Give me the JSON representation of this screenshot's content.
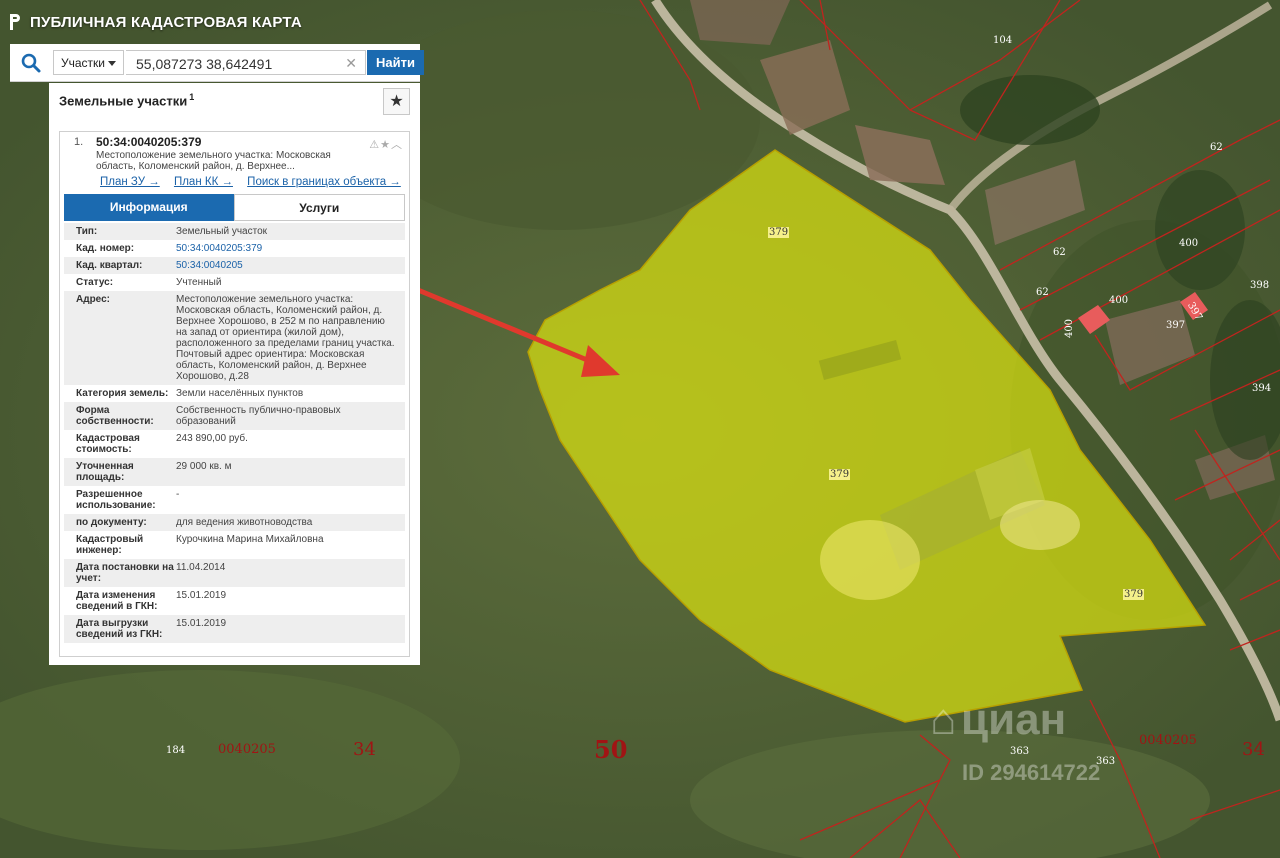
{
  "app": {
    "title": "ПУБЛИЧНАЯ КАДАСТРОВАЯ КАРТА"
  },
  "search": {
    "type_label": "Участки",
    "query": "55,087273 38,642491",
    "find_label": "Найти"
  },
  "panel": {
    "title": "Земельные участки",
    "count": "1",
    "result": {
      "index": "1.",
      "cad_number": "50:34:0040205:379",
      "address_short": "Местоположение земельного участка: Московская область, Коломенский район, д. Верхнее...",
      "links": [
        "План ЗУ →",
        "План КК →",
        "Поиск в границах объекта →"
      ],
      "tabs": [
        "Информация",
        "Услуги"
      ],
      "rows": [
        {
          "k": "Тип:",
          "v": "Земельный участок"
        },
        {
          "k": "Кад. номер:",
          "v": "50:34:0040205:379",
          "link": true
        },
        {
          "k": "Кад. квартал:",
          "v": "50:34:0040205",
          "link": true
        },
        {
          "k": "Статус:",
          "v": "Учтенный"
        },
        {
          "k": "Адрес:",
          "v": "Местоположение земельного участка: Московская область, Коломенский район, д. Верхнее Хорошово, в 252 м по направлению на запад от ориентира (жилой дом), расположенного за пределами границ участка. Почтовый адрес ориентира: Московская область, Коломенский район, д. Верхнее Хорошово, д.28"
        },
        {
          "k": "Категория земель:",
          "v": "Земли населённых пунктов"
        },
        {
          "k": "Форма собственности:",
          "v": "Собственность публично-правовых образований"
        },
        {
          "k": "Кадастровая стоимость:",
          "v": "243 890,00 руб."
        },
        {
          "k": "Уточненная площадь:",
          "v": "29 000 кв. м"
        },
        {
          "k": "Разрешенное использование:",
          "v": "-"
        },
        {
          "k": "по документу:",
          "v": "для ведения животноводства"
        },
        {
          "k": "Кадастровый инженер:",
          "v": "Курочкина Марина Михайловна"
        },
        {
          "k": "Дата постановки на учет:",
          "v": "11.04.2014"
        },
        {
          "k": "Дата изменения сведений в ГКН:",
          "v": "15.01.2019"
        },
        {
          "k": "Дата выгрузки сведений из ГКН:",
          "v": "15.01.2019"
        }
      ]
    }
  },
  "map": {
    "parcel_labels": [
      "379",
      "379",
      "379"
    ],
    "small_labels": [
      "104",
      "62",
      "62",
      "62",
      "400",
      "400",
      "398",
      "397",
      "394",
      "400",
      "397",
      "363",
      "363",
      "184"
    ],
    "quarter_labels": [
      "0040205",
      "34",
      "50",
      "0040205",
      "34"
    ],
    "watermark": "циан",
    "watermark_id": "ID 294614722"
  }
}
